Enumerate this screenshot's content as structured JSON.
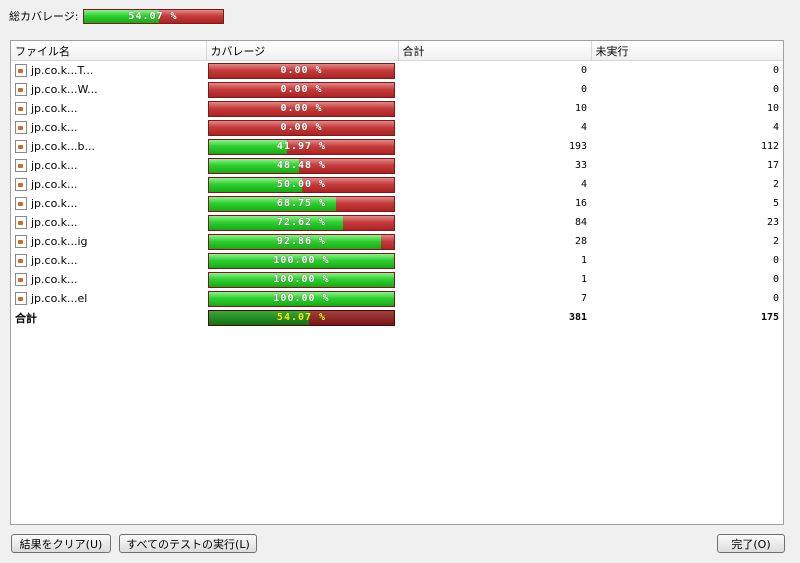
{
  "summary": {
    "label": "総カバレージ:",
    "percent_text": "54.07 %",
    "coverage": 0.5407
  },
  "table": {
    "headers": [
      "ファイル名",
      "カバレージ",
      "合計",
      "未実行"
    ],
    "rows": [
      {
        "name": "jp.co.k...T...",
        "coverage": 0.0,
        "coverage_text": "0.00 %",
        "total": "0",
        "unexecuted": "0"
      },
      {
        "name": "jp.co.k...W...",
        "coverage": 0.0,
        "coverage_text": "0.00 %",
        "total": "0",
        "unexecuted": "0"
      },
      {
        "name": "jp.co.k...",
        "coverage": 0.0,
        "coverage_text": "0.00 %",
        "total": "10",
        "unexecuted": "10"
      },
      {
        "name": "jp.co.k...",
        "coverage": 0.0,
        "coverage_text": "0.00 %",
        "total": "4",
        "unexecuted": "4"
      },
      {
        "name": "jp.co.k...b...",
        "coverage": 0.4197,
        "coverage_text": "41.97 %",
        "total": "193",
        "unexecuted": "112"
      },
      {
        "name": "jp.co.k...",
        "coverage": 0.4848,
        "coverage_text": "48.48 %",
        "total": "33",
        "unexecuted": "17"
      },
      {
        "name": "jp.co.k...",
        "coverage": 0.5,
        "coverage_text": "50.00 %",
        "total": "4",
        "unexecuted": "2"
      },
      {
        "name": "jp.co.k...",
        "coverage": 0.6875,
        "coverage_text": "68.75 %",
        "total": "16",
        "unexecuted": "5"
      },
      {
        "name": "jp.co.k...",
        "coverage": 0.7262,
        "coverage_text": "72.62 %",
        "total": "84",
        "unexecuted": "23"
      },
      {
        "name": "jp.co.k...ig",
        "coverage": 0.9286,
        "coverage_text": "92.86 %",
        "total": "28",
        "unexecuted": "2"
      },
      {
        "name": "jp.co.k...",
        "coverage": 1.0,
        "coverage_text": "100.00 %",
        "total": "1",
        "unexecuted": "0"
      },
      {
        "name": "jp.co.k...",
        "coverage": 1.0,
        "coverage_text": "100.00 %",
        "total": "1",
        "unexecuted": "0"
      },
      {
        "name": "jp.co.k...el",
        "coverage": 1.0,
        "coverage_text": "100.00 %",
        "total": "7",
        "unexecuted": "0"
      }
    ],
    "total_row": {
      "label": "合計",
      "coverage": 0.5407,
      "coverage_text": "54.07 %",
      "total": "381",
      "unexecuted": "175"
    }
  },
  "buttons": {
    "clear": "結果をクリア(U)",
    "run_all": "すべてのテストの実行(L)",
    "done": "完了(O)"
  },
  "colors": {
    "covered": "#2fcf2f",
    "uncovered": "#c73b3b",
    "total_text": "#f4f400"
  }
}
